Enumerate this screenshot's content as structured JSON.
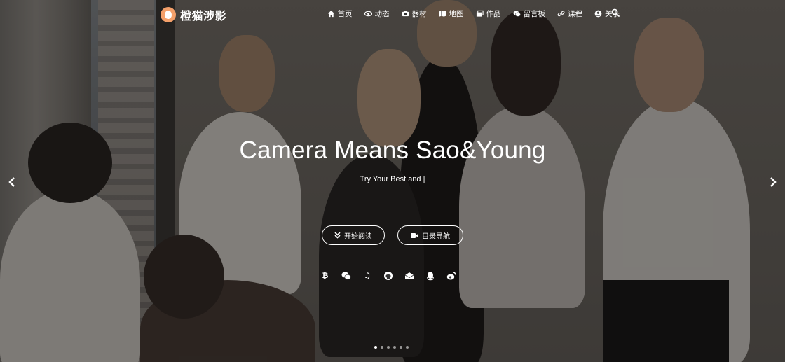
{
  "brand": {
    "name": "橙猫涉影"
  },
  "nav": {
    "items": [
      {
        "label": "首页",
        "icon": "home-icon"
      },
      {
        "label": "动态",
        "icon": "eye-icon"
      },
      {
        "label": "器材",
        "icon": "camera-icon"
      },
      {
        "label": "地图",
        "icon": "map-icon"
      },
      {
        "label": "作品",
        "icon": "images-icon"
      },
      {
        "label": "留言板",
        "icon": "comments-icon"
      },
      {
        "label": "课程",
        "icon": "link-icon"
      },
      {
        "label": "关于",
        "icon": "user-circle-icon"
      }
    ],
    "search_icon": "search-icon"
  },
  "hero": {
    "title": "Camera Means Sao&Young",
    "subtitle": "Try Your Best and |",
    "buttons": {
      "read": "开始阅读",
      "catalog": "目录导航"
    },
    "socials": [
      "bitcoin-icon",
      "wechat-icon",
      "music-icon",
      "github-icon",
      "mail-icon",
      "qq-icon",
      "weibo-icon"
    ],
    "carousel": {
      "slides": 6,
      "active": 1
    }
  },
  "colors": {
    "brand": "#f4a06a",
    "text": "#ffffff"
  }
}
